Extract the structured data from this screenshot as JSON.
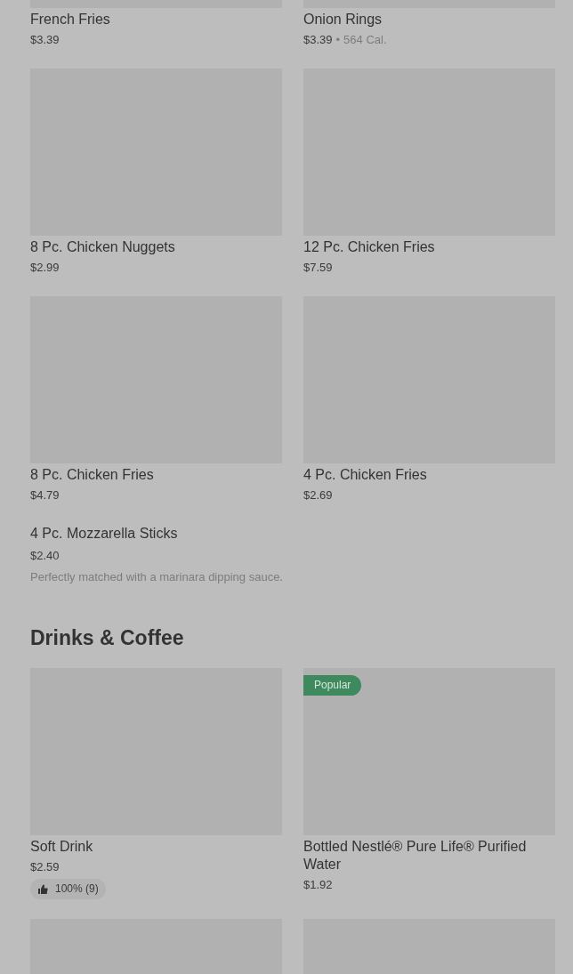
{
  "sections": [
    {
      "items": [
        {
          "kind": "image-card",
          "name": "French Fries",
          "price": "$3.39"
        },
        {
          "kind": "image-card",
          "name": "Onion Rings",
          "price": "$3.39",
          "separator": "•",
          "calories": "564 Cal."
        },
        {
          "kind": "image-card",
          "name": "8 Pc. Chicken Nuggets",
          "price": "$2.99"
        },
        {
          "kind": "image-card",
          "name": "12 Pc. Chicken Fries",
          "price": "$7.59"
        },
        {
          "kind": "image-card",
          "name": "8 Pc. Chicken Fries",
          "price": "$4.79"
        },
        {
          "kind": "image-card",
          "name": "4 Pc. Chicken Fries",
          "price": "$2.69"
        },
        {
          "kind": "text-item",
          "name": "4 Pc. Mozzarella Sticks",
          "price": "$2.40",
          "description": "Perfectly matched with a marinara dipping sauce."
        }
      ]
    },
    {
      "heading": "Drinks & Coffee",
      "items": [
        {
          "kind": "image-card",
          "name": "Soft Drink",
          "price": "$2.59",
          "rating": "100% (9)"
        },
        {
          "kind": "image-card",
          "name": "Bottled Nestlé® Pure Life® Purified Water",
          "price": "$1.92",
          "badge": "Popular"
        },
        {
          "kind": "image-only"
        },
        {
          "kind": "image-only"
        }
      ]
    }
  ]
}
